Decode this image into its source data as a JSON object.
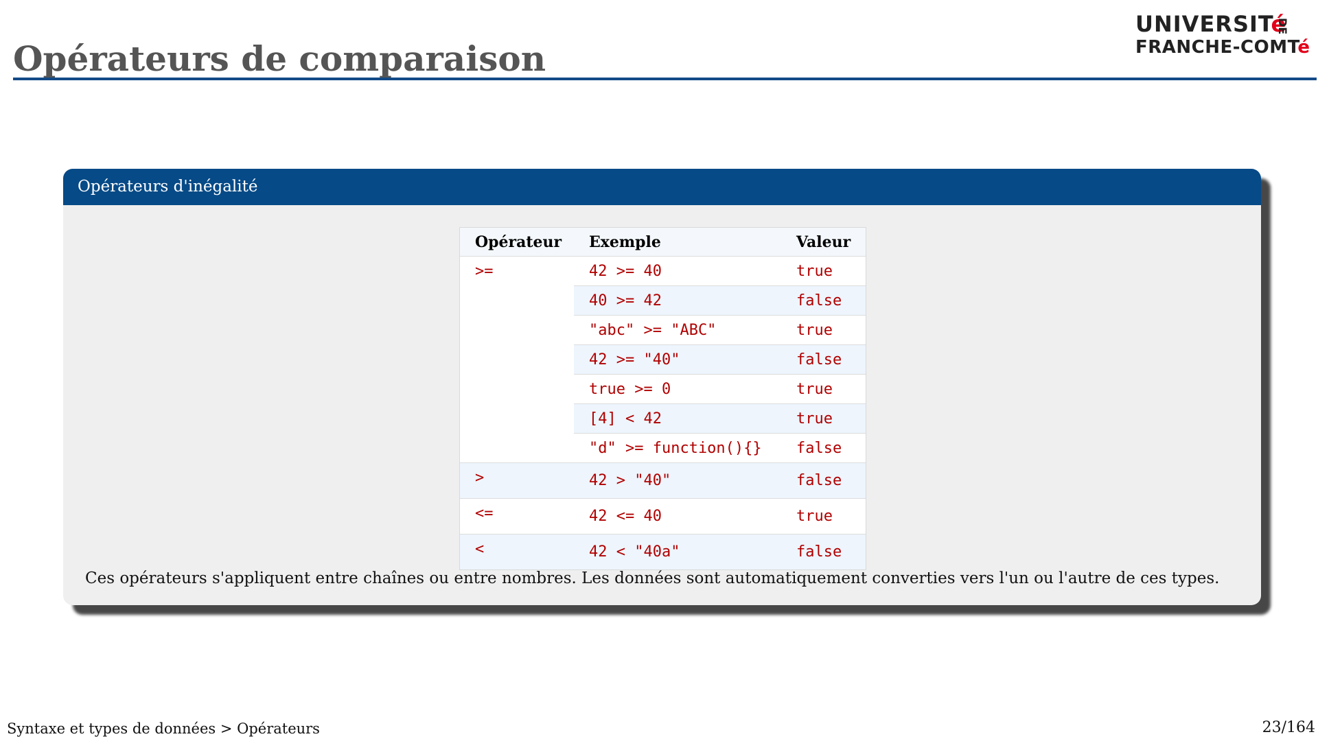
{
  "slide": {
    "title": "Opérateurs de comparaison",
    "logo": {
      "line1": "UNIVERSITé",
      "line2": "FRANCHE-COMTé",
      "side": "DE",
      "accent_color": "#e2001a"
    }
  },
  "block": {
    "title": "Opérateurs d'inégalité",
    "header_color": "#064a87",
    "table": {
      "headers": [
        "Opérateur",
        "Exemple",
        "Valeur"
      ],
      "groups": [
        {
          "operator": ">=",
          "rows": [
            {
              "example": "42 >= 40",
              "value": "true"
            },
            {
              "example": "40 >= 42",
              "value": "false"
            },
            {
              "example": "\"abc\" >= \"ABC\"",
              "value": "true"
            },
            {
              "example": "42 >= \"40\"",
              "value": "false"
            },
            {
              "example": "true >= 0",
              "value": "true"
            },
            {
              "example": "[4] < 42",
              "value": "true"
            },
            {
              "example": "\"d\" >= function(){}",
              "value": "false"
            }
          ]
        },
        {
          "operator": ">",
          "rows": [
            {
              "example": "42 > \"40\"",
              "value": "false"
            }
          ]
        },
        {
          "operator": "<=",
          "rows": [
            {
              "example": "42 <= 40",
              "value": "true"
            }
          ]
        },
        {
          "operator": "<",
          "rows": [
            {
              "example": "42 < \"40a\"",
              "value": "false"
            }
          ]
        }
      ]
    },
    "note": "Ces opérateurs s'appliquent entre chaînes ou entre nombres. Les données sont automatiquement converties vers l'un ou l'autre de ces types."
  },
  "footer": {
    "breadcrumb": "Syntaxe et types de données > Opérateurs",
    "page": "23/164"
  }
}
